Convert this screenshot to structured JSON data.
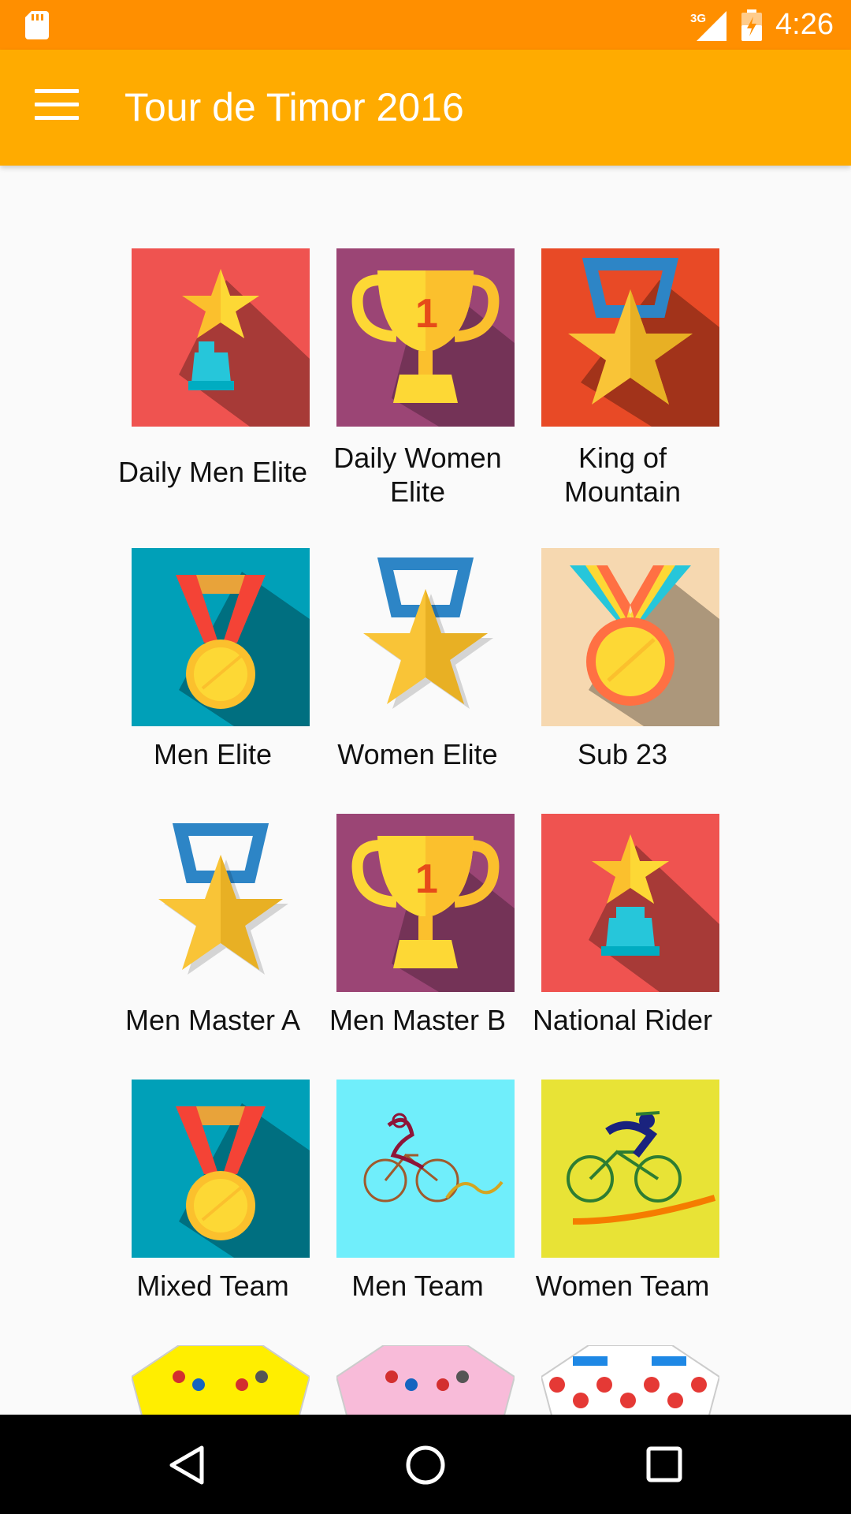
{
  "status_bar": {
    "time": "4:26",
    "network": "3G",
    "icons": [
      "sd-card-icon",
      "cell-signal-icon",
      "battery-charging-icon"
    ]
  },
  "app_bar": {
    "title": "Tour de Timor 2016",
    "menu_icon": "hamburger-menu-icon"
  },
  "categories": [
    {
      "label": "Daily Men Elite",
      "icon": "star-trophy-icon",
      "bg": "#ef5350"
    },
    {
      "label": "Daily Women\nElite",
      "icon": "cup-trophy-icon",
      "bg": "#9b4575"
    },
    {
      "label": "King of\nMountain",
      "icon": "star-medal-icon",
      "bg": "#e84a26"
    },
    {
      "label": "Men Elite",
      "icon": "medal-icon",
      "bg": "#00a0b8"
    },
    {
      "label": "Women Elite",
      "icon": "star-medal-icon",
      "bg": "transparent"
    },
    {
      "label": "Sub 23",
      "icon": "medal-icon",
      "bg": "#f6d8b0"
    },
    {
      "label": "Men Master A",
      "icon": "star-medal-icon",
      "bg": "transparent"
    },
    {
      "label": "Men Master B",
      "icon": "cup-trophy-icon",
      "bg": "#9b4575"
    },
    {
      "label": "National Rider",
      "icon": "star-trophy-icon",
      "bg": "#ef5350"
    },
    {
      "label": "Mixed Team",
      "icon": "medal-icon",
      "bg": "#00a0b8"
    },
    {
      "label": "Men Team",
      "icon": "cyclist-icon",
      "bg": "#70eefb"
    },
    {
      "label": "Women Team",
      "icon": "cyclist-icon",
      "bg": "#e8e336"
    },
    {
      "label": "",
      "icon": "yellow-jersey-icon",
      "bg": "transparent"
    },
    {
      "label": "",
      "icon": "pink-jersey-icon",
      "bg": "transparent"
    },
    {
      "label": "",
      "icon": "polka-dot-jersey-icon",
      "bg": "transparent"
    }
  ],
  "nav_bar": {
    "icons": [
      "back-icon",
      "home-icon",
      "recents-icon"
    ]
  }
}
